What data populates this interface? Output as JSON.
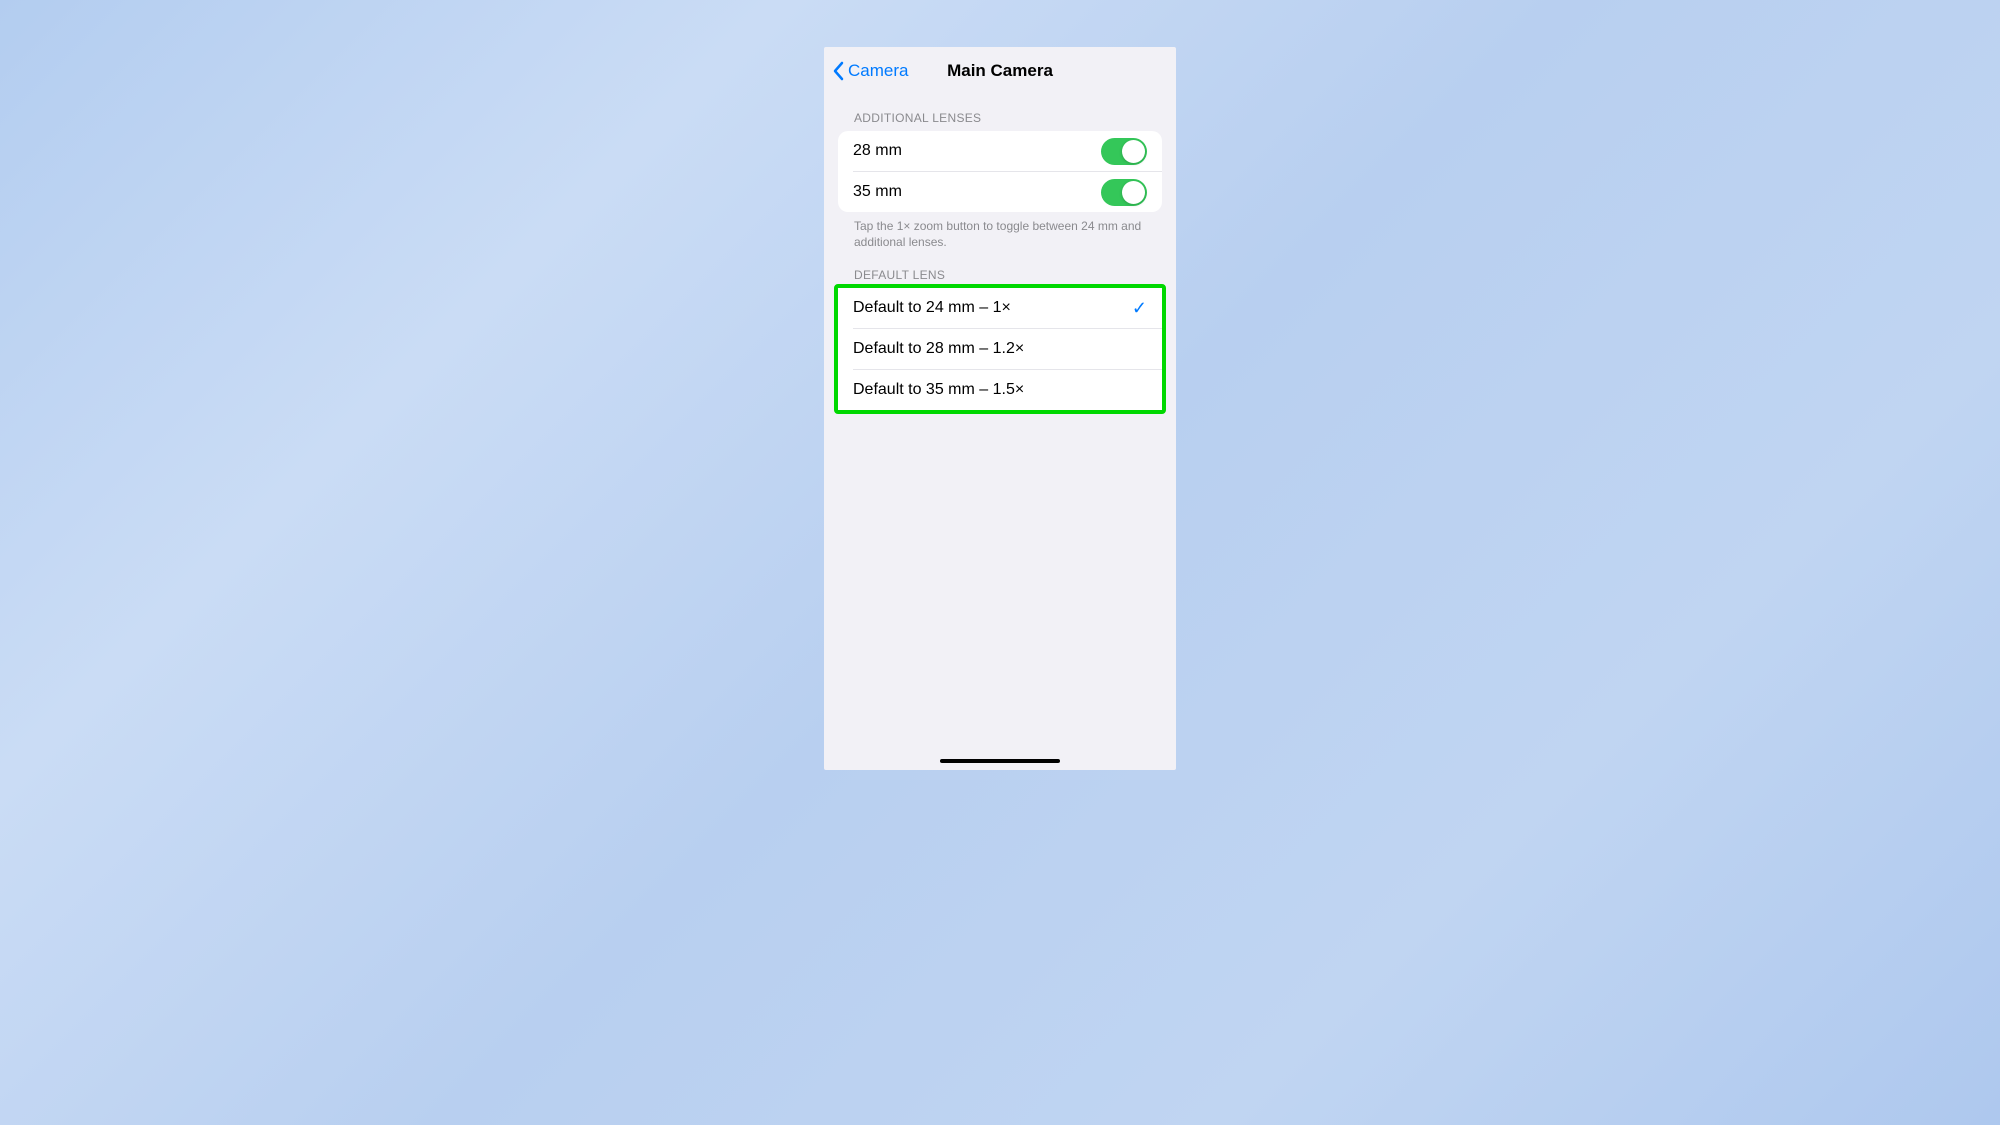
{
  "nav": {
    "back_label": "Camera",
    "title": "Main Camera"
  },
  "sections": {
    "additional_lenses": {
      "header": "ADDITIONAL LENSES",
      "items": [
        {
          "label": "28 mm",
          "enabled": true
        },
        {
          "label": "35 mm",
          "enabled": true
        }
      ],
      "footer": "Tap the 1× zoom button to toggle between 24 mm and additional lenses."
    },
    "default_lens": {
      "header": "DEFAULT LENS",
      "items": [
        {
          "label": "Default to 24 mm – 1×",
          "selected": true
        },
        {
          "label": "Default to 28 mm – 1.2×",
          "selected": false
        },
        {
          "label": "Default to 35 mm – 1.5×",
          "selected": false
        }
      ]
    }
  },
  "checkmark": "✓"
}
